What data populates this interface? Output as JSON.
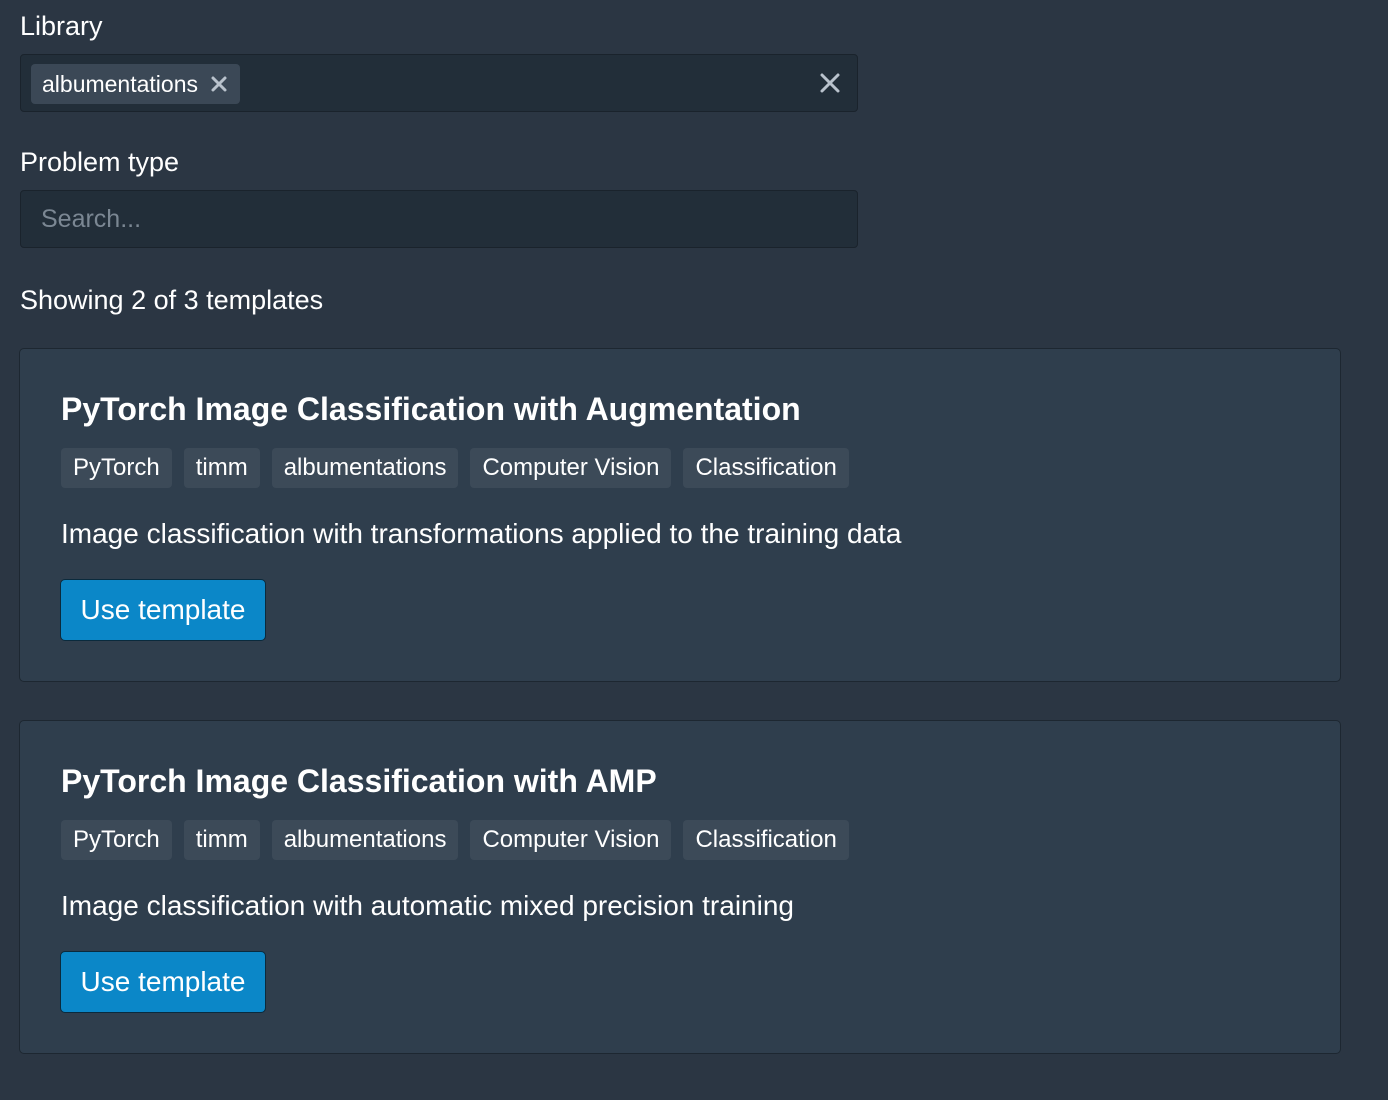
{
  "filters": {
    "library": {
      "label": "Library",
      "selected": [
        {
          "value": "albumentations"
        }
      ]
    },
    "problem_type": {
      "label": "Problem type",
      "placeholder": "Search..."
    }
  },
  "results": {
    "summary": "Showing 2 of 3 templates"
  },
  "templates": [
    {
      "title": "PyTorch Image Classification with Augmentation",
      "tags": [
        "PyTorch",
        "timm",
        "albumentations",
        "Computer Vision",
        "Classification"
      ],
      "description": "Image classification with transformations applied to the training data",
      "button_label": "Use template"
    },
    {
      "title": "PyTorch Image Classification with AMP",
      "tags": [
        "PyTorch",
        "timm",
        "albumentations",
        "Computer Vision",
        "Classification"
      ],
      "description": "Image classification with automatic mixed precision training",
      "button_label": "Use template"
    }
  ],
  "icons": {
    "chip_remove": "close-icon",
    "clear_all": "close-icon"
  },
  "colors": {
    "background": "#2b3643",
    "card": "#2f3e4d",
    "primary_button": "#0b87c8",
    "tag": "#3c4a58"
  }
}
